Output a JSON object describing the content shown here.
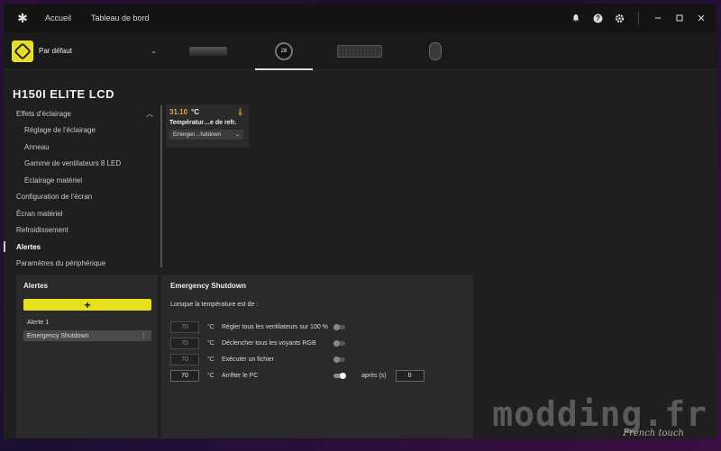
{
  "titlebar": {
    "nav": [
      "Accueil",
      "Tableau de bord"
    ],
    "icons": [
      "bell-icon",
      "help-icon",
      "gear-icon",
      "minimize-icon",
      "maximize-icon",
      "close-icon"
    ]
  },
  "profile": {
    "name": "Par défaut"
  },
  "devices": {
    "pump_label": "28"
  },
  "device_title": "H150I ELITE LCD",
  "sidebar": {
    "items": [
      {
        "label": "Effets d'éclairage"
      },
      {
        "label": "Réglage de l'éclairage"
      },
      {
        "label": "Anneau"
      },
      {
        "label": "Gamme de ventilateurs 8 LED"
      },
      {
        "label": "Éclairage matériel"
      },
      {
        "label": "Configuration de l'écran"
      },
      {
        "label": "Écran matériel"
      },
      {
        "label": "Refroidissement"
      },
      {
        "label": "Alertes"
      },
      {
        "label": "Paramètres du périphérique"
      }
    ]
  },
  "temp_card": {
    "value": "31.10",
    "unit": "°C",
    "name": "Températur…e de refr.",
    "select": "Emergen…hutdown"
  },
  "alerts": {
    "title": "Alertes",
    "add_label": "+",
    "items": [
      "Alerte 1",
      "Emergency Shutdown"
    ]
  },
  "emergency": {
    "title": "Emergency Shutdown",
    "subtitle": "Lorsque la température est de :",
    "rows": [
      {
        "value": "70",
        "unit": "°C",
        "label": "Régler tous les ventilateurs sur 100 %"
      },
      {
        "value": "70",
        "unit": "°C",
        "label": "Déclencher tous les voyants RGB"
      },
      {
        "value": "70",
        "unit": "°C",
        "label": "Exécuter un fichier"
      },
      {
        "value": "70",
        "unit": "°C",
        "label": "Arrêter le PC"
      }
    ],
    "after_label": "après (s)",
    "after_value": "0"
  },
  "watermark": {
    "text": "modding.fr",
    "sub": "French touch"
  },
  "colors": {
    "accent": "#e8e01f",
    "temp": "#f0a030"
  }
}
